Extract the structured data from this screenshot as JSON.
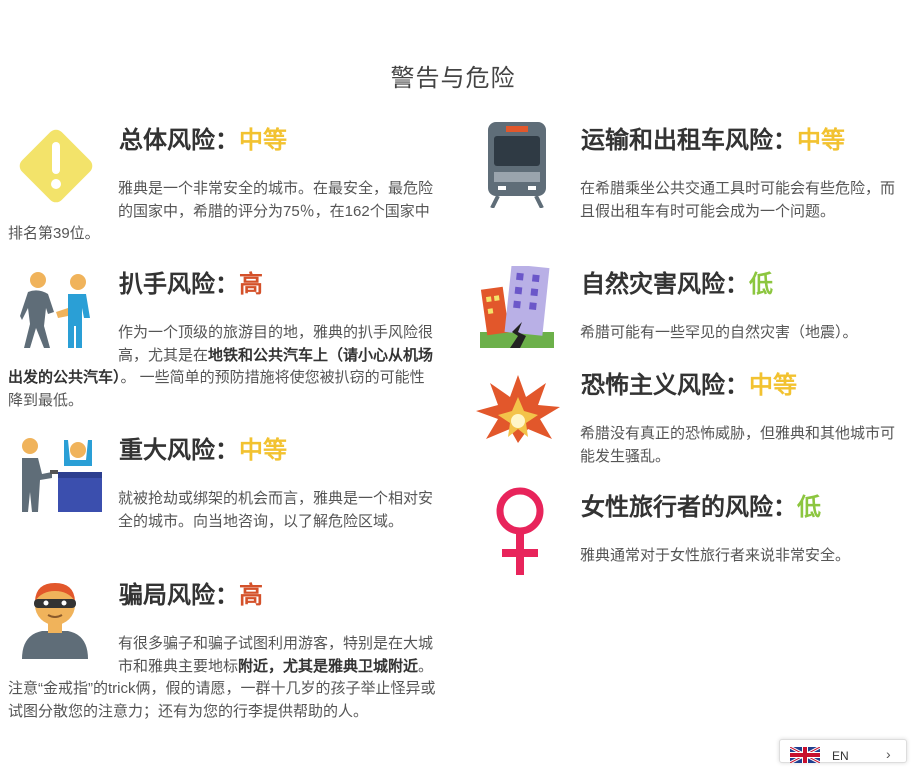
{
  "page_title": "警告与危险",
  "colors": {
    "medium": "#f2c230",
    "high": "#d4512a",
    "low": "#8cc63f"
  },
  "risks": {
    "overall": {
      "icon": "warning-diamond-icon",
      "title": "总体风险：",
      "level": "中等",
      "desc": "雅典是一个非常安全的城市。在最安全，最危险的国家中，希腊的评分为75％，在162个国家中排名第39位。"
    },
    "pickpocket": {
      "icon": "pickpocket-icon",
      "title": "扒手风险：",
      "level": "高",
      "desc_1": "作为一个顶级的旅游目的地，雅典的扒手风险很高，尤其是在",
      "desc_bold": "地铁和公共汽车上（请小心从机场出发的公共汽车）",
      "desc_2": "。 一些简单的预防措施将使您被扒窃的可能性降到最低。"
    },
    "mugging": {
      "icon": "robbery-icon",
      "title": "重大风险：",
      "level": "中等",
      "desc": "就被抢劫或绑架的机会而言，雅典是一个相对安全的城市。向当地咨询，以了解危险区域。"
    },
    "scam": {
      "icon": "scammer-icon",
      "title": "骗局风险：",
      "level": "高",
      "desc_1": "有很多骗子和骗子试图利用游客，特别是在大城市和雅典主要地标",
      "desc_bold_1": "附近，尤其是雅典卫城附近",
      "desc_2": "。注意“金戒指”的trick俩，假的请愿，一群十几岁的孩子举止怪异或试图分散您的注意力；还有为您的行李提供帮助的人。"
    },
    "transport": {
      "icon": "train-icon",
      "title": "运输和出租车风险：",
      "level": "中等",
      "desc": "在希腊乘坐公共交通工具时可能会有些危险，而且假出租车有时可能会成为一个问题。"
    },
    "natural": {
      "icon": "earthquake-icon",
      "title": "自然灾害风险：",
      "level": "低",
      "desc": "希腊可能有一些罕见的自然灾害（地震）。"
    },
    "terrorism": {
      "icon": "explosion-icon",
      "title": "恐怖主义风险：",
      "level": "中等",
      "desc": "希腊没有真正的恐怖威胁，但雅典和其他城市可能发生骚乱。"
    },
    "women": {
      "icon": "female-symbol-icon",
      "title": "女性旅行者的风险：",
      "level": "低",
      "desc": "雅典通常对于女性旅行者来说非常安全。"
    }
  },
  "language_switcher": {
    "code": "EN",
    "flag": "uk-flag-icon"
  }
}
